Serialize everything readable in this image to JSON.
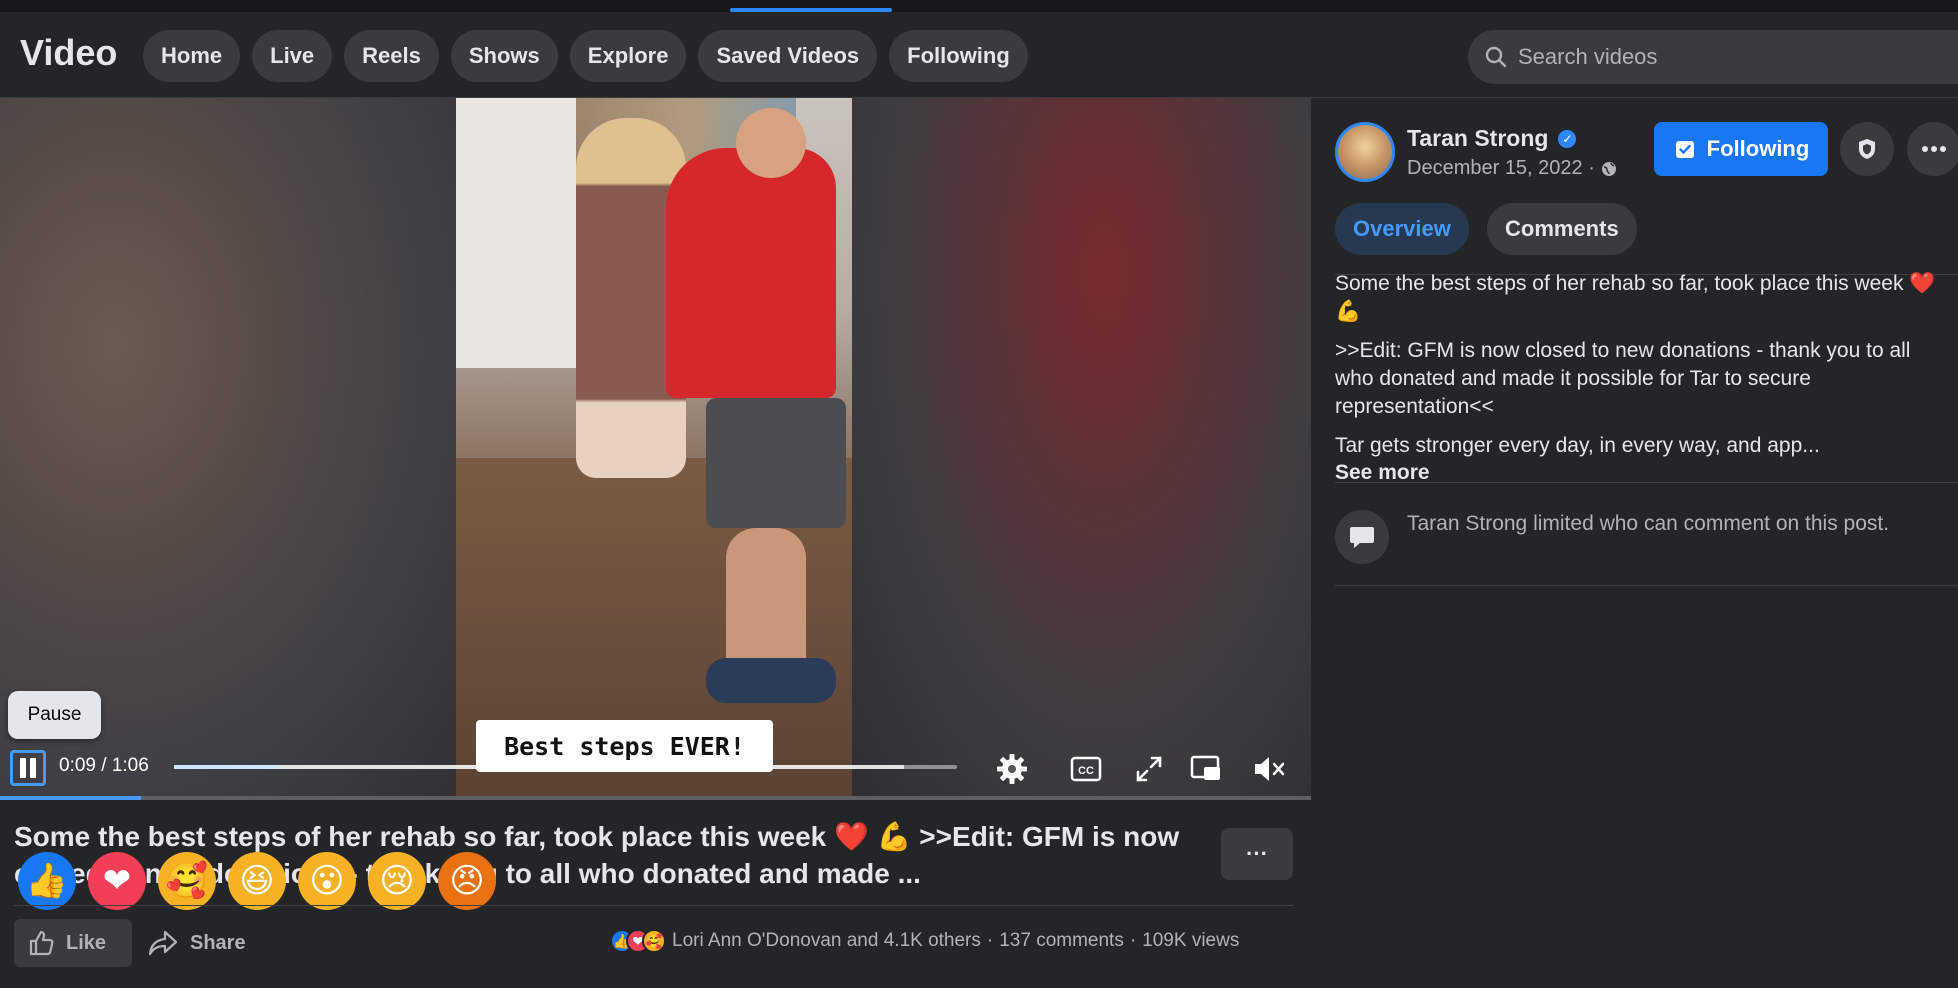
{
  "header": {
    "brand": "Video",
    "tabs": [
      "Home",
      "Live",
      "Reels",
      "Shows",
      "Explore",
      "Saved Videos",
      "Following"
    ],
    "search_placeholder": "Search videos"
  },
  "player": {
    "caption": "Best steps EVER!",
    "pause_tooltip": "Pause",
    "timecode": "0:09 / 1:06",
    "progress_fraction": 0.136,
    "icons": [
      "pause-icon",
      "settings-icon",
      "captions-icon",
      "fullscreen-icon",
      "miniplayer-icon",
      "muted-volume-icon"
    ]
  },
  "post": {
    "title": "Some the best steps of her rehab so far, took place this week ❤️ 💪 >>Edit: GFM is now closed to new donations - thank you to all who donated and made ...",
    "title_visible_line2": "ns - thank you to all who donated and made ...",
    "more_label": "···",
    "reactions": [
      {
        "name": "like",
        "glyph": "👍",
        "bg": "#1877f2"
      },
      {
        "name": "love",
        "glyph": "❤",
        "bg": "#f33e58"
      },
      {
        "name": "care",
        "glyph": "🥰",
        "bg": "#f7b125"
      },
      {
        "name": "haha",
        "glyph": "😆",
        "bg": "#f7b125"
      },
      {
        "name": "wow",
        "glyph": "😮",
        "bg": "#f7b125"
      },
      {
        "name": "sad",
        "glyph": "😢",
        "bg": "#f7b125"
      },
      {
        "name": "angry",
        "glyph": "😠",
        "bg": "#e9710f"
      }
    ],
    "like_label": "Like",
    "share_label": "Share",
    "reactors": "Lori Ann O'Donovan and 4.1K others",
    "comments": "137 comments",
    "views": "109K views",
    "dot": "·"
  },
  "sidebar": {
    "author": "Taran Strong",
    "date": "December 15, 2022 ·",
    "follow_label": "Following",
    "tabs": [
      "Overview",
      "Comments"
    ],
    "desc1": "Some the best steps of her rehab so far, took place this week ❤️ 💪",
    "desc2": ">>Edit: GFM is now closed to new donations - thank you to all who donated and made it possible for Tar to secure representation<<",
    "desc3": "Tar gets stronger every day, in every way, and app...",
    "see_more": "See more",
    "limited_notice": "Taran Strong limited who can comment on this post."
  }
}
